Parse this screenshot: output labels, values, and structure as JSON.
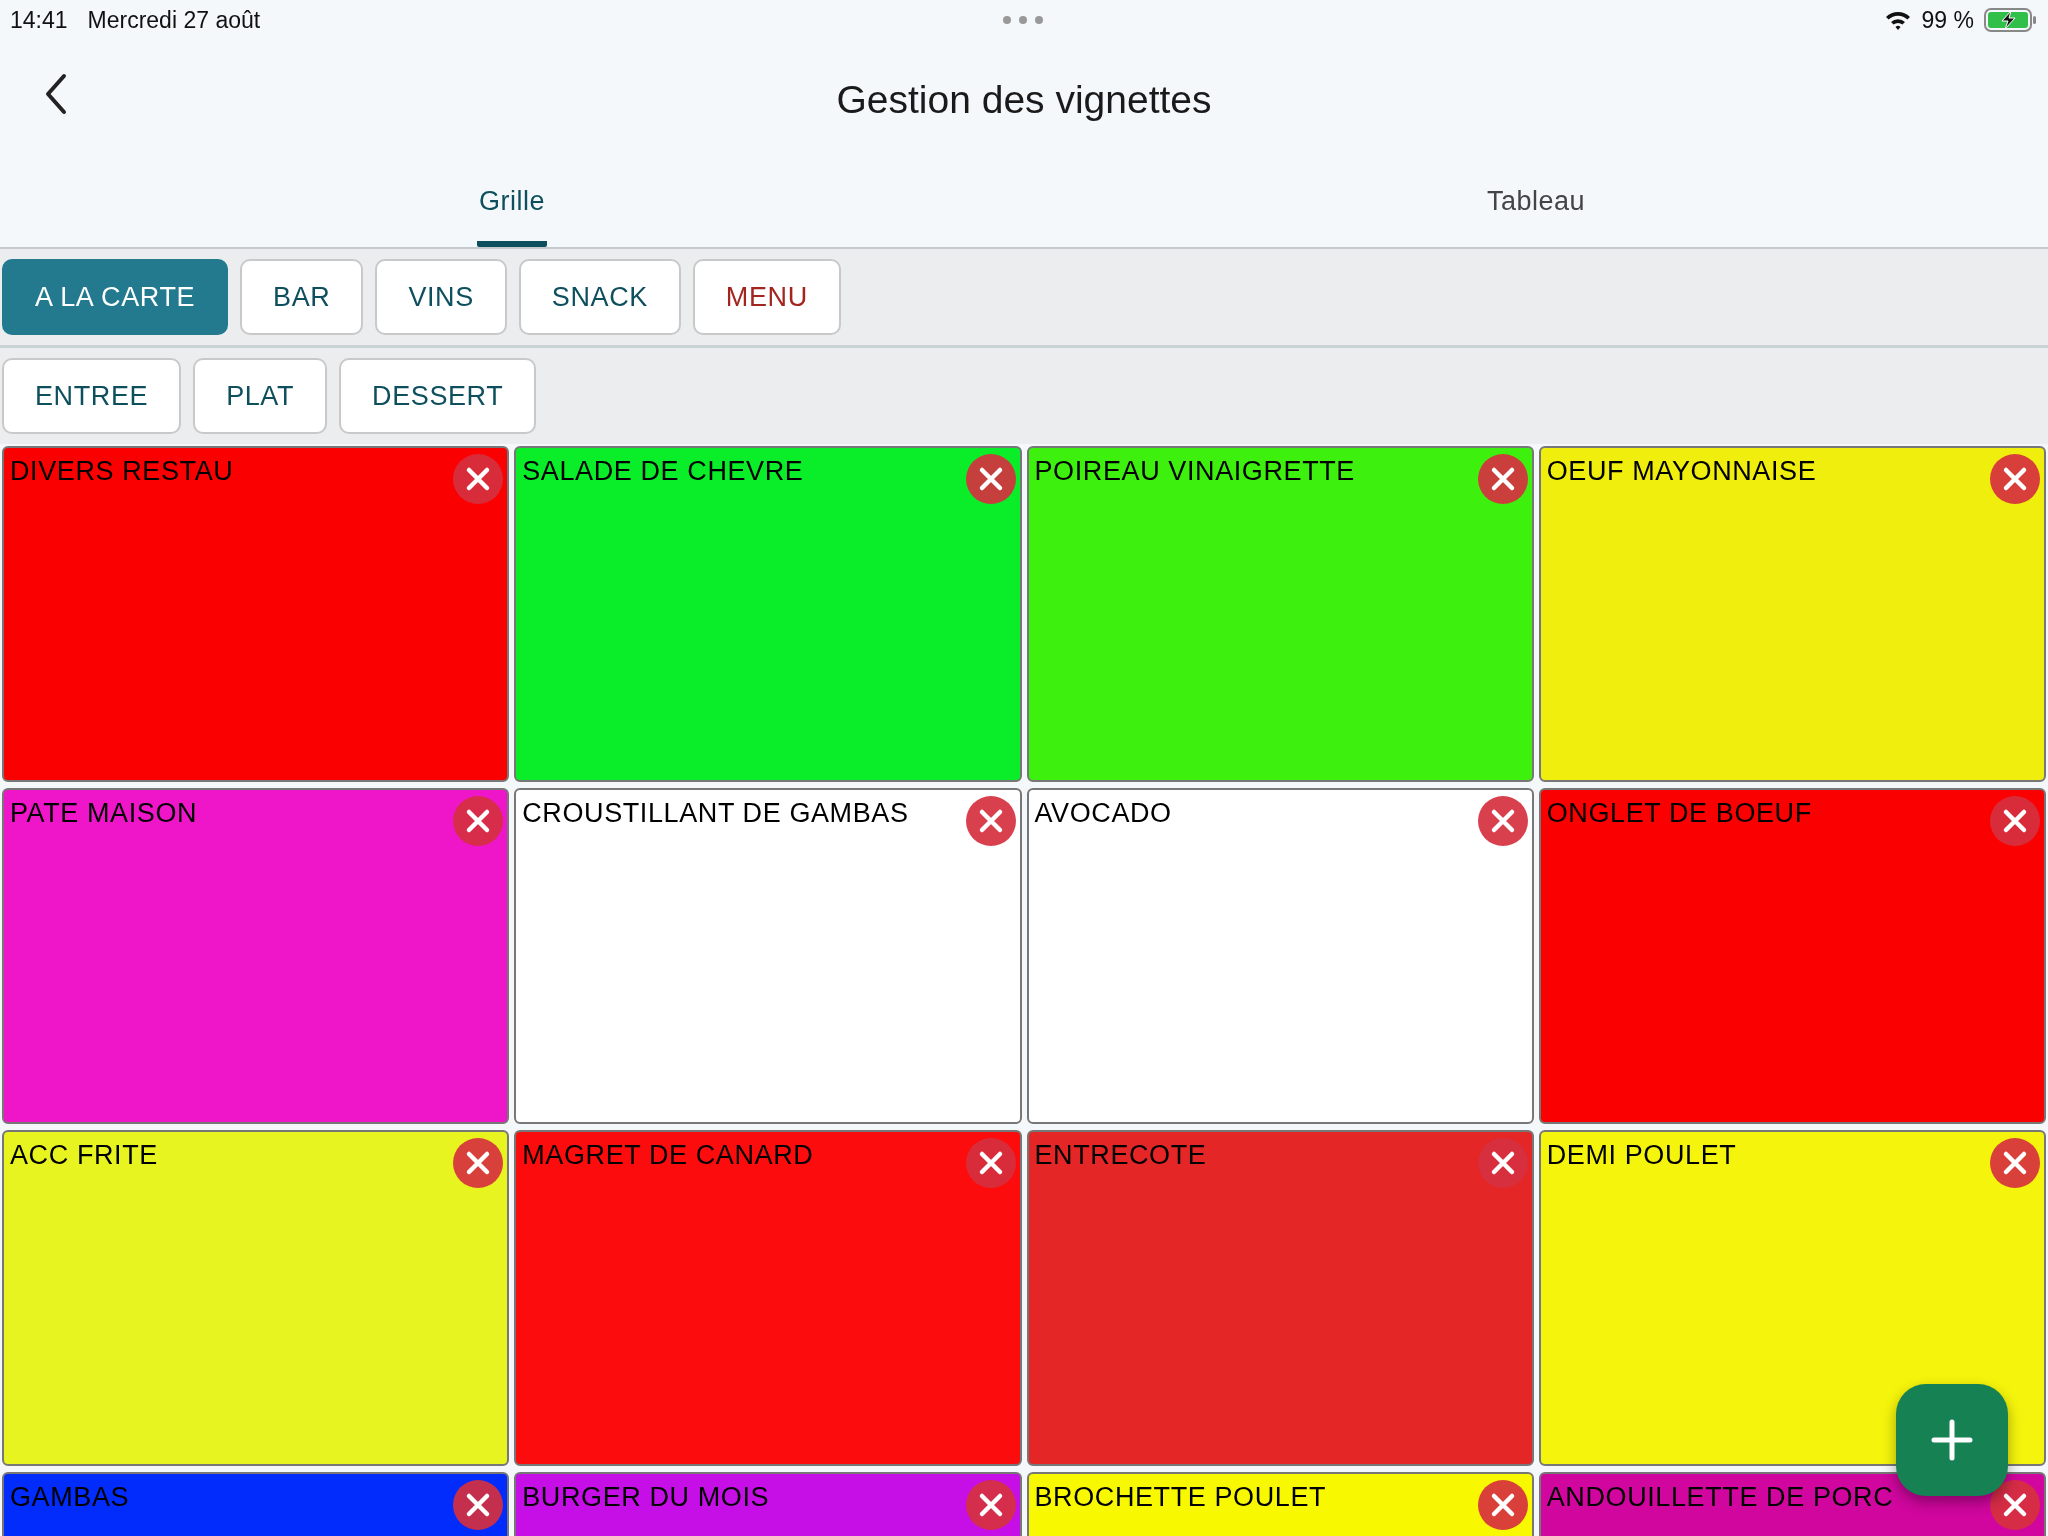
{
  "status_bar": {
    "time": "14:41",
    "date": "Mercredi 27 août",
    "battery": "99 %"
  },
  "header": {
    "title": "Gestion des vignettes"
  },
  "tabs": [
    {
      "label": "Grille",
      "selected": true
    },
    {
      "label": "Tableau",
      "selected": false
    }
  ],
  "categories": [
    {
      "label": "A LA CARTE",
      "selected": true,
      "color": "#237a8f"
    },
    {
      "label": "BAR",
      "selected": false,
      "color": "#0e4f5e"
    },
    {
      "label": "VINS",
      "selected": false,
      "color": "#0e4f5e"
    },
    {
      "label": "SNACK",
      "selected": false,
      "color": "#0e4f5e"
    },
    {
      "label": "MENU",
      "selected": false,
      "color": "#a3251e"
    }
  ],
  "subcategories": [
    {
      "label": "ENTREE"
    },
    {
      "label": "PLAT"
    },
    {
      "label": "DESSERT"
    }
  ],
  "tiles": [
    {
      "label": "DIVERS RESTAU",
      "color": "#fb0000"
    },
    {
      "label": "SALADE DE CHEVRE",
      "color": "#0aee2a"
    },
    {
      "label": "POIREAU VINAIGRETTE",
      "color": "#3ef00e"
    },
    {
      "label": "OEUF MAYONNAISE",
      "color": "#f0ee0c"
    },
    {
      "label": "PATE MAISON",
      "color": "#ee16c8"
    },
    {
      "label": "CROUSTILLANT DE GAMBAS",
      "color": "#ffffff"
    },
    {
      "label": "AVOCADO",
      "color": "#ffffff"
    },
    {
      "label": "ONGLET DE BOEUF",
      "color": "#fb0000"
    },
    {
      "label": "ACC FRITE",
      "color": "#e8f420"
    },
    {
      "label": "MAGRET DE CANARD",
      "color": "#fc0c0c"
    },
    {
      "label": "ENTRECOTE",
      "color": "#e52626"
    },
    {
      "label": "DEMI POULET",
      "color": "#f5f40c"
    },
    {
      "label": "GAMBAS",
      "color": "#022cfc"
    },
    {
      "label": "BURGER DU MOIS",
      "color": "#c50fe6"
    },
    {
      "label": "BROCHETTE POULET",
      "color": "#f8f800"
    },
    {
      "label": "ANDOUILLETTE DE PORC",
      "color": "#d0069e"
    }
  ]
}
